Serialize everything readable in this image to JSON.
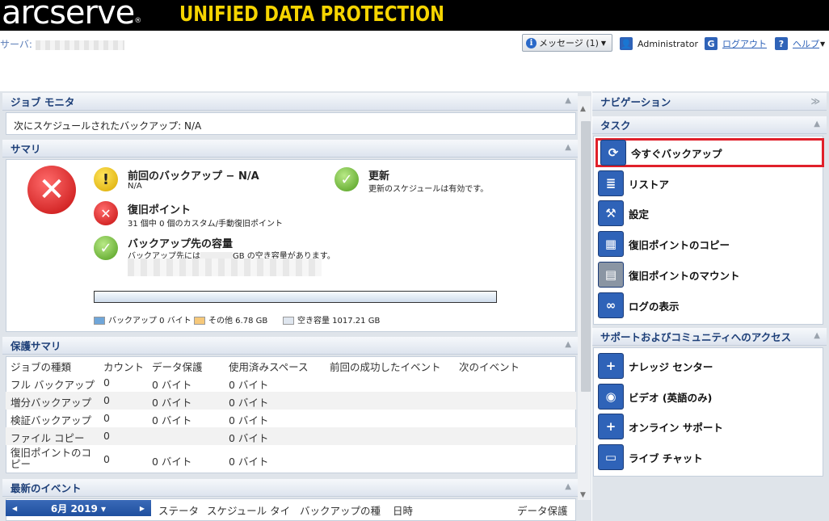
{
  "header": {
    "brand": "arcserve",
    "brand_mark": "®",
    "product": "UNIFIED DATA PROTECTION",
    "server_label": "サーバ:",
    "messages_label": "メッセージ (1)",
    "user": "Administrator",
    "logout": "ログアウト",
    "help": "ヘルプ"
  },
  "job_monitor": {
    "title": "ジョブ モニタ",
    "next_backup": "次にスケジュールされたバックアップ: N/A"
  },
  "summary": {
    "title": "サマリ",
    "last_backup_title": "前回のバックアップ − N/A",
    "last_backup_sub": "N/A",
    "update_title": "更新",
    "update_sub": "更新のスケジュールは有効です。",
    "recovery_title": "復旧ポイント",
    "recovery_sub": "31 個中 0 個のカスタム/手動復旧ポイント",
    "dest_title": "バックアップ先の容量",
    "dest_sub_pre": "バックアップ先には",
    "dest_sub_post": "GB の空き容量があります。",
    "legend_backup": "バックアップ 0 バイト",
    "legend_other": "その他 6.78 GB",
    "legend_free": "空き容量 1017.21 GB"
  },
  "protection": {
    "title": "保護サマリ",
    "headers": [
      "ジョブの種類",
      "カウント",
      "データ保護",
      "使用済みスペース",
      "前回の成功したイベント",
      "次のイベント"
    ],
    "rows": [
      {
        "type": "フル バックアップ",
        "count": "0",
        "data": "0 バイト",
        "used": "0 バイト"
      },
      {
        "type": "増分バックアップ",
        "count": "0",
        "data": "0 バイト",
        "used": "0 バイト"
      },
      {
        "type": "検証バックアップ",
        "count": "0",
        "data": "0 バイト",
        "used": "0 バイト"
      },
      {
        "type": "ファイル コピー",
        "count": "0",
        "data": "",
        "used": "0 バイト"
      },
      {
        "type": "復旧ポイントのコピー",
        "count": "0",
        "data": "0 バイト",
        "used": "0 バイト"
      }
    ]
  },
  "events": {
    "title": "最新のイベント",
    "month": "6月 2019",
    "cols": [
      "ステータ",
      "スケジュール タイ",
      "バックアップの種",
      "日時",
      "データ保護"
    ]
  },
  "nav": {
    "title": "ナビゲーション",
    "tasks_title": "タスク",
    "tasks": [
      "今すぐバックアップ",
      "リストア",
      "設定",
      "復旧ポイントのコピー",
      "復旧ポイントのマウント",
      "ログの表示"
    ],
    "support_title": "サポートおよびコミュニティへのアクセス",
    "support": [
      "ナレッジ センター",
      "ビデオ (英語のみ)",
      "オンライン サポート",
      "ライブ チャット"
    ]
  },
  "colors": {
    "accent": "#2f63b8",
    "highlight": "#e0202a",
    "brand_yellow": "#f5d400"
  }
}
